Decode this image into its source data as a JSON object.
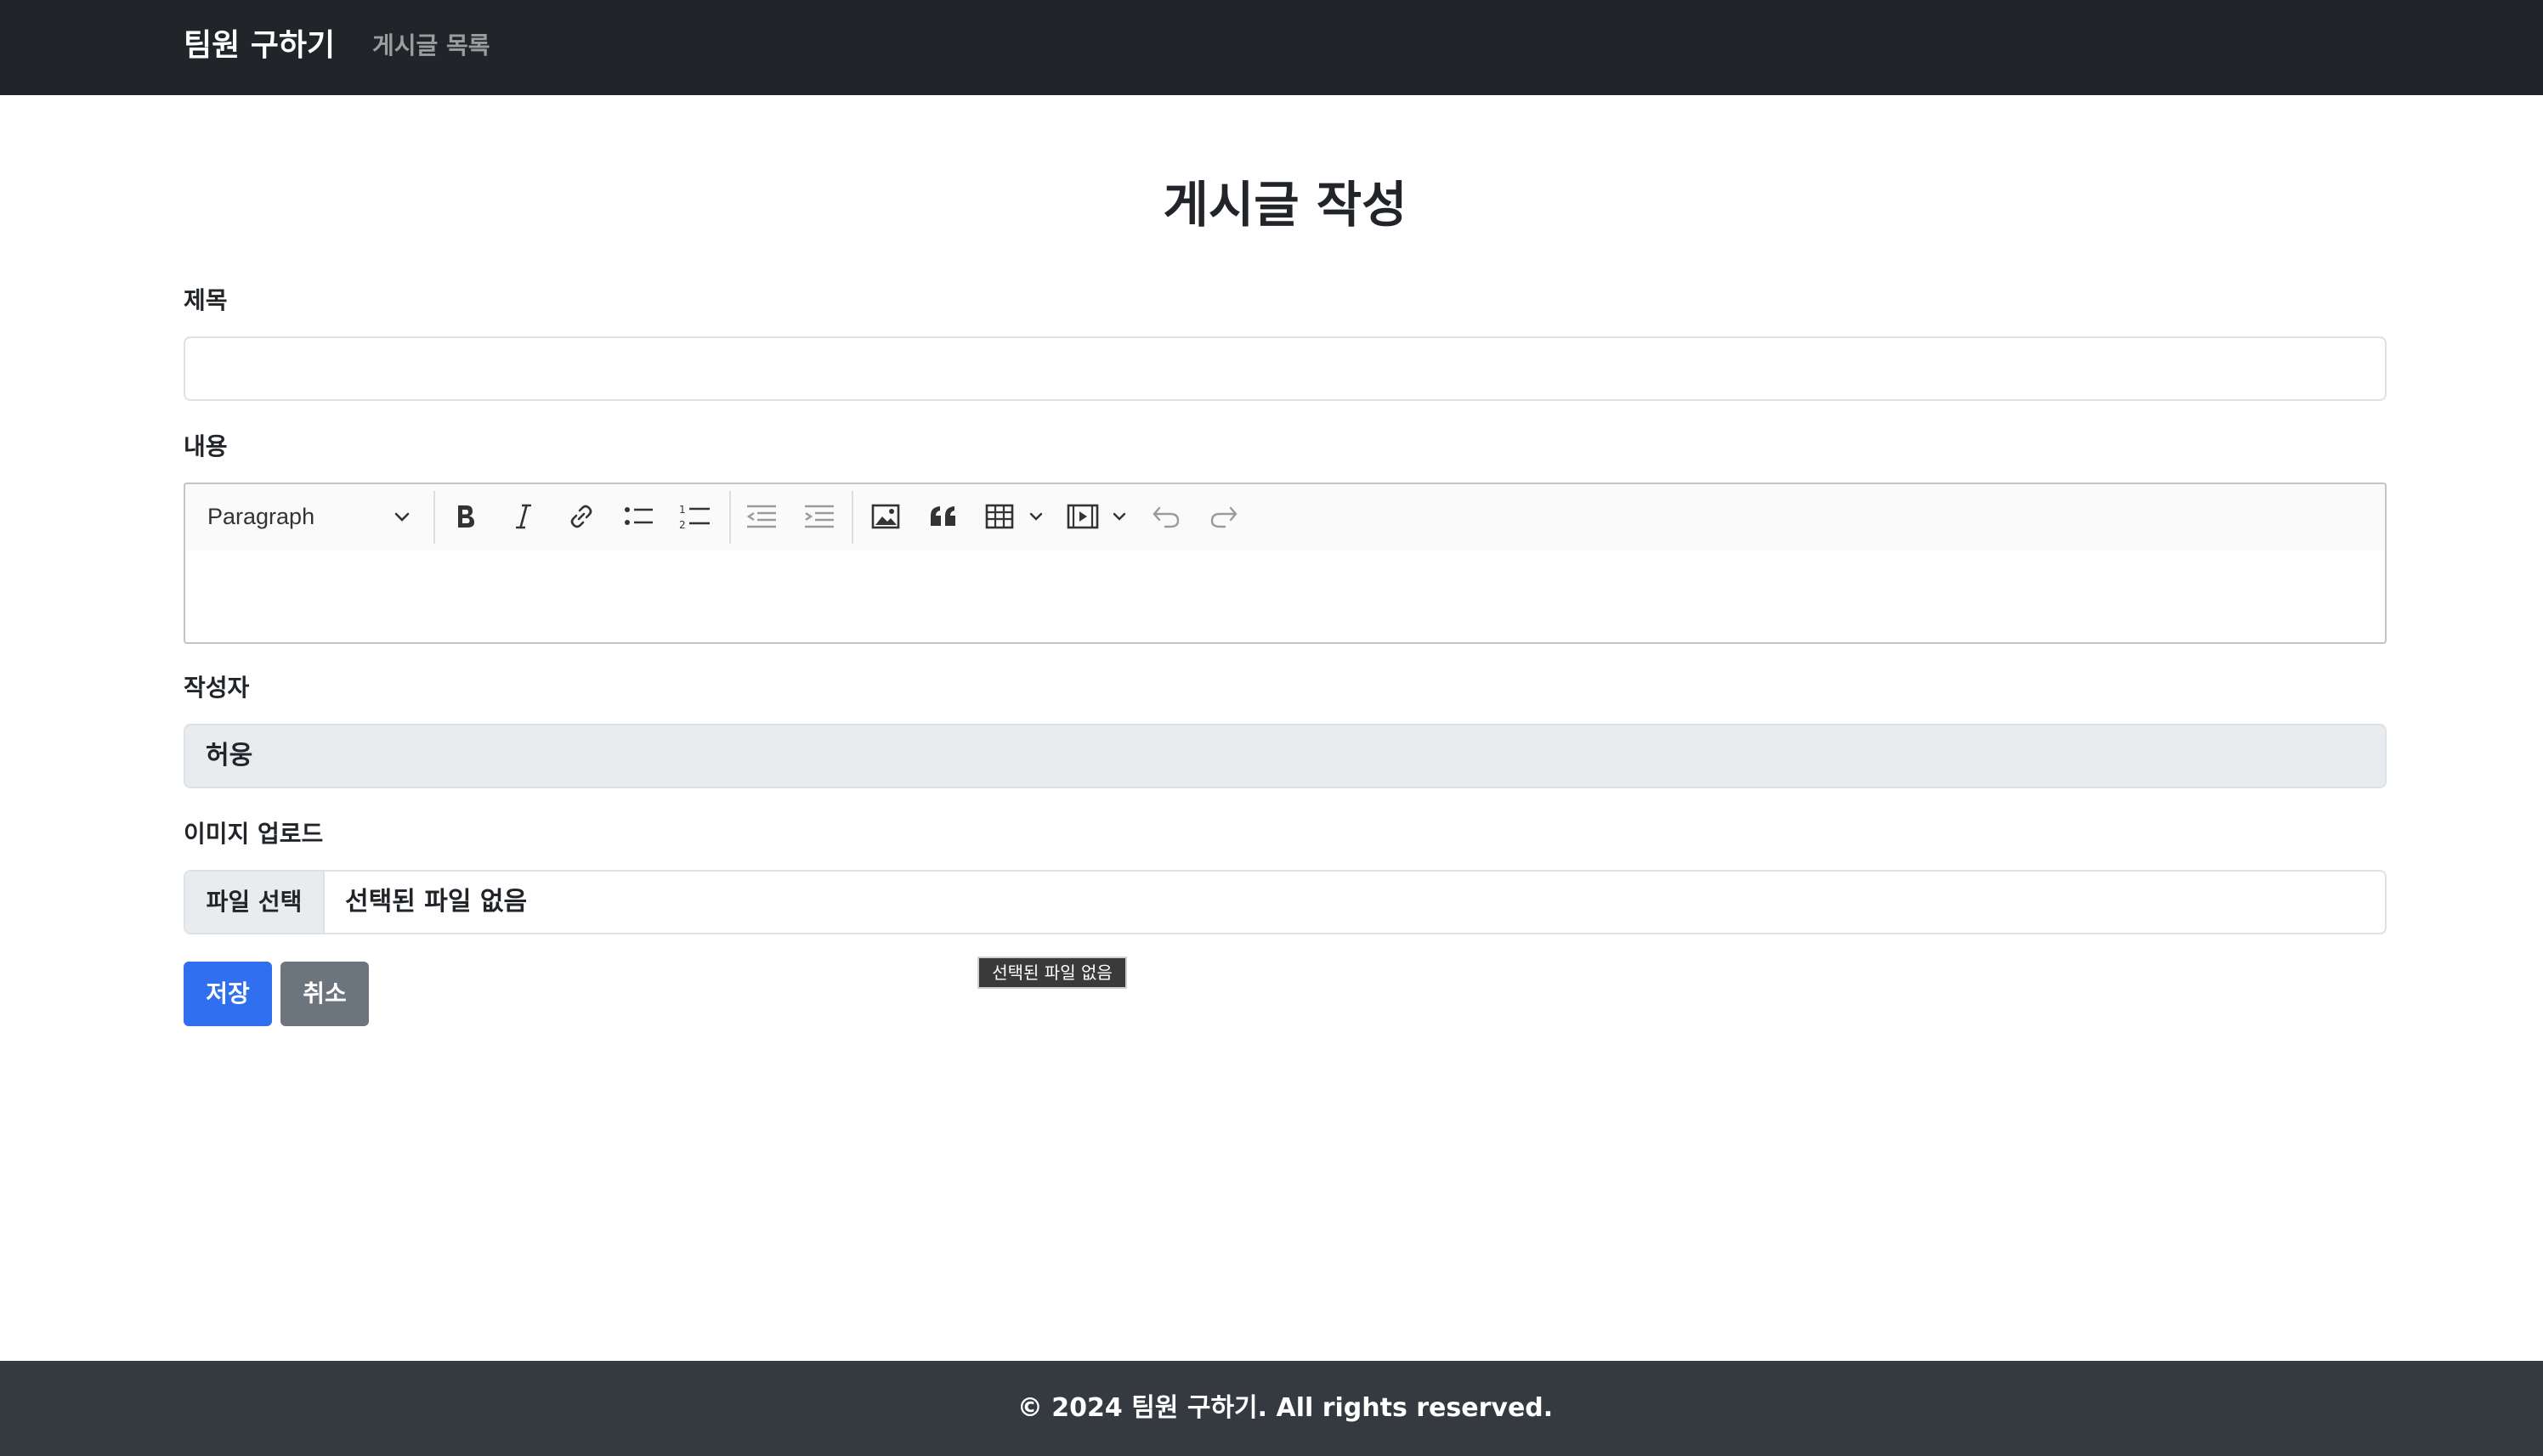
{
  "navbar": {
    "brand": "팀원 구하기",
    "links": [
      "게시글 목록"
    ]
  },
  "page": {
    "title": "게시글 작성"
  },
  "form": {
    "title_label": "제목",
    "title_value": "",
    "content_label": "내용",
    "editor": {
      "heading_value": "Paragraph",
      "toolbar_icons": [
        "bold-icon",
        "italic-icon",
        "link-icon",
        "bulleted-list-icon",
        "numbered-list-icon",
        "outdent-icon",
        "indent-icon",
        "image-icon",
        "blockquote-icon",
        "table-icon",
        "media-icon",
        "undo-icon",
        "redo-icon"
      ],
      "content": ""
    },
    "author_label": "작성자",
    "author_value": "허웅",
    "image_label": "이미지 업로드",
    "file_button": "파일 선택",
    "file_status": "선택된 파일 없음",
    "tooltip": "선택된 파일 없음",
    "save_button": "저장",
    "cancel_button": "취소"
  },
  "footer": {
    "text": "© 2024 팀원 구하기. All rights reserved."
  },
  "colors": {
    "navbar_bg": "#212529",
    "footer_bg": "#343a40",
    "primary": "#2f6ff0",
    "secondary": "#6c757d"
  }
}
